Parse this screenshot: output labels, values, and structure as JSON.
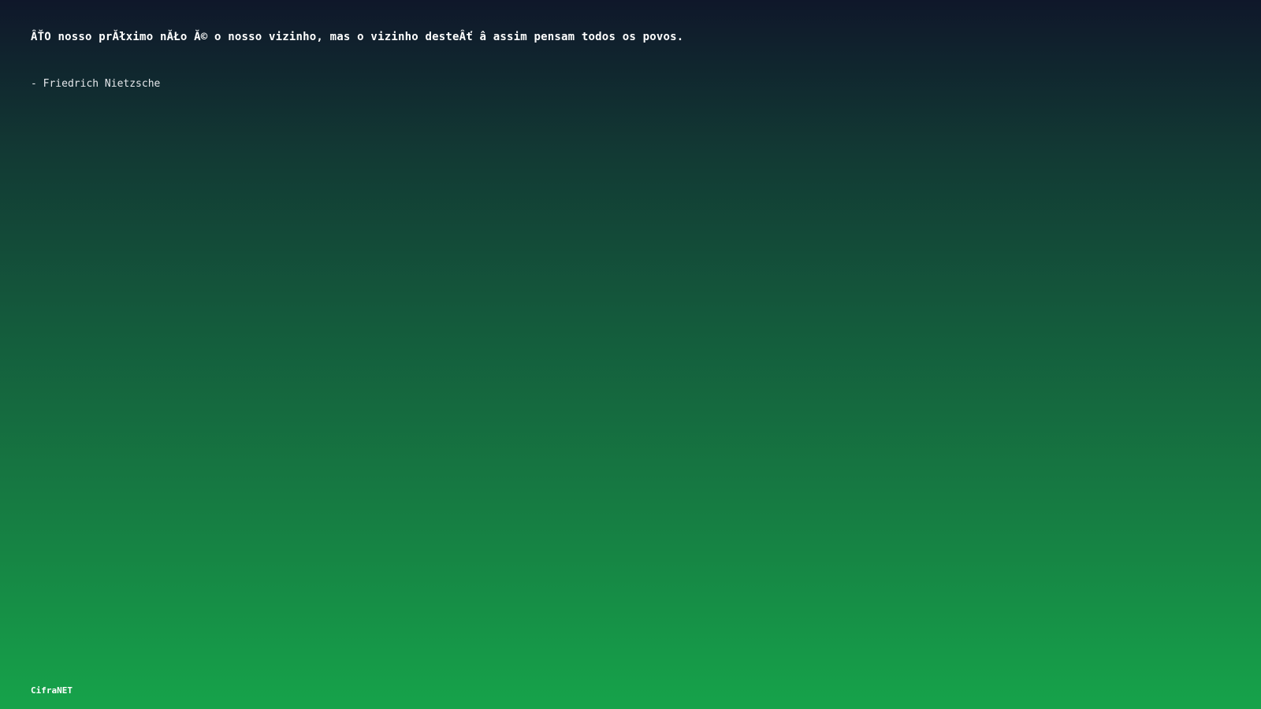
{
  "quote": {
    "text": "ÂŤO nosso prĂłximo nĂŁo Ă© o nosso vizinho, mas o vizinho desteÂť â assim pensam todos os povos.",
    "author": "- Friedrich Nietzsche"
  },
  "footer": {
    "brand": "CifraNET"
  }
}
